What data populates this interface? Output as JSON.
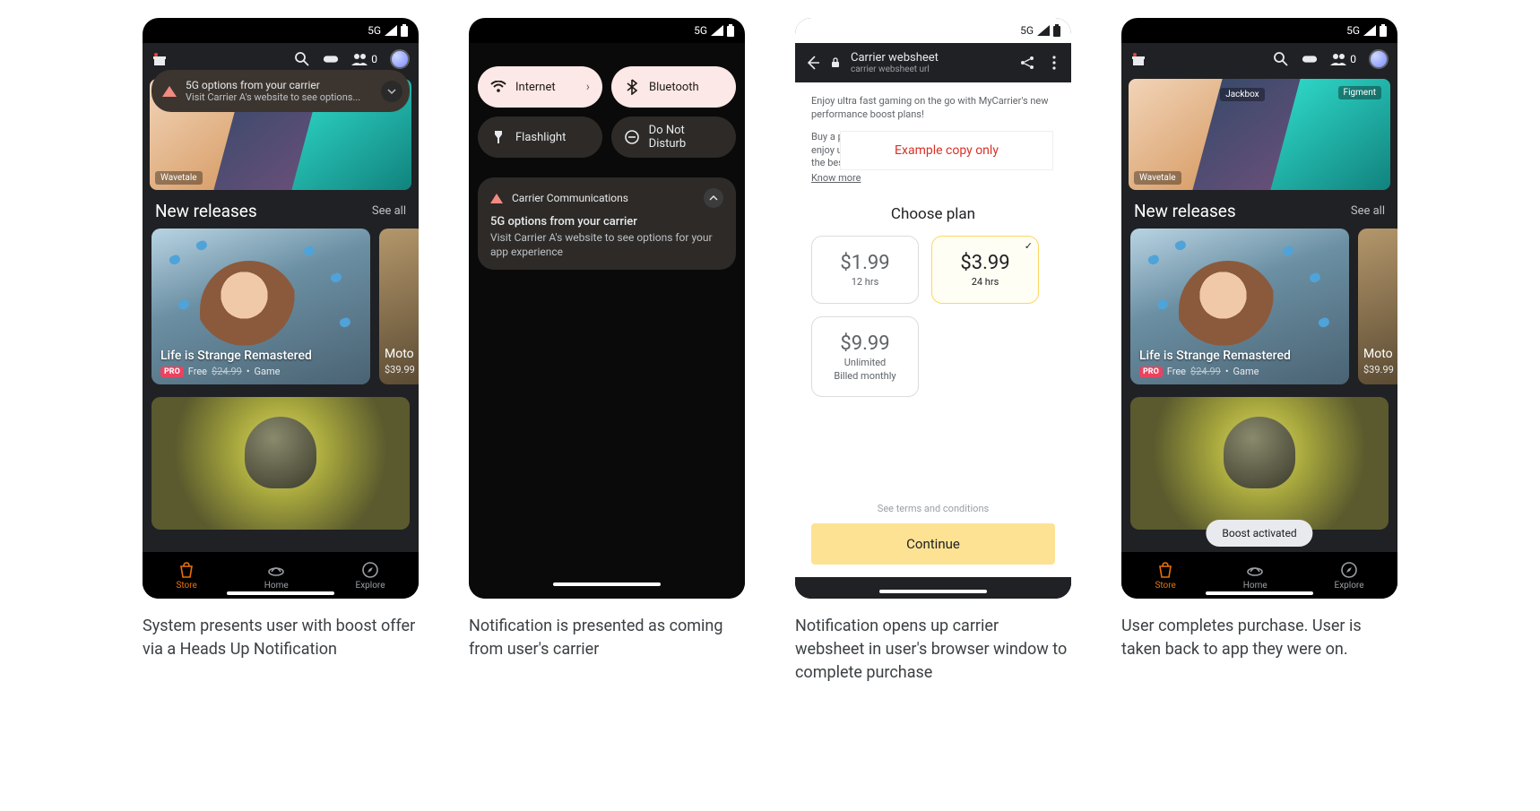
{
  "status": {
    "net": "5G"
  },
  "store": {
    "friends_count": "0",
    "hero": {
      "t1": "Wavetale",
      "t2": "Jackbox",
      "t3": "Figment"
    },
    "section": {
      "title": "New releases",
      "see_all": "See all"
    },
    "card1": {
      "title": "Life is Strange Remastered",
      "pro": "PRO",
      "free": "Free",
      "strike": "$24.99",
      "cat": "Game"
    },
    "card2": {
      "title": "Moto",
      "price": "$39.99"
    },
    "nav": {
      "store": "Store",
      "home": "Home",
      "explore": "Explore"
    }
  },
  "hun": {
    "title": "5G options from your carrier",
    "body": "Visit Carrier A's website to see options..."
  },
  "qs": {
    "internet": "Internet",
    "bluetooth": "Bluetooth",
    "flashlight": "Flashlight",
    "dnd": "Do Not Disturb"
  },
  "notif": {
    "app": "Carrier Communications",
    "title": "5G options from your carrier",
    "body": "Visit Carrier A's website to see options for your app experience"
  },
  "ws": {
    "title": "Carrier websheet",
    "url": "carrier websheet url",
    "intro1": "Enjoy ultra fast gaming on the go with MyCarrier's new performance boost plans!",
    "intro2": "Buy a pass or subscribe to an unlimited monthly plan to enjoy uninterrupted gaming at the fastest data rates for the best on-the-go mobile gaming experience!",
    "know": "Know more",
    "overlay": "Example copy only",
    "choose": "Choose plan",
    "plans": [
      {
        "price": "$1.99",
        "dur": "12 hrs"
      },
      {
        "price": "$3.99",
        "dur": "24 hrs"
      },
      {
        "price": "$9.99",
        "dur": "Unlimited",
        "dur2": "Billed monthly"
      }
    ],
    "terms": "See terms and conditions",
    "continue": "Continue"
  },
  "toast": "Boost activated",
  "captions": [
    "System presents user with boost offer via a Heads Up Notification",
    "Notification is presented as coming from user's carrier",
    "Notification opens up carrier websheet in user's browser window to complete purchase",
    "User completes purchase. User is taken back to app they were on."
  ]
}
